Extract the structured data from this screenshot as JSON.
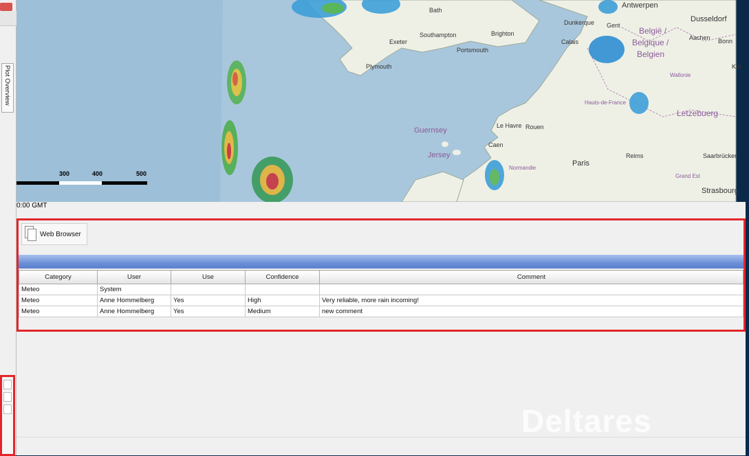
{
  "sidebar": {
    "plot_overview_label": "Plot Overview"
  },
  "map": {
    "cities": [
      "Antwerpen",
      "Bath",
      "Dusseldorf",
      "Dunkerque",
      "Gent",
      "Aachen",
      "Bonn",
      "Southampton",
      "Brighton",
      "Exeter",
      "Portsmouth",
      "Calais",
      "België /",
      "Belgique /",
      "Belgien",
      "Plymouth",
      "Wallonie",
      "Hauts-de-France",
      "Letzebuerg",
      "Guernsey",
      "Le Havre",
      "Rouen",
      "Caen",
      "Jersey",
      "Reims",
      "Saarbrücken",
      "Paris",
      "Grand Est",
      "Strasbourg",
      "Normandie",
      "Kob"
    ],
    "scale": {
      "ticks": [
        "300",
        "400",
        "500"
      ]
    }
  },
  "time_label": "0:00 GMT",
  "toolbar": {
    "web_browser_label": "Web Browser"
  },
  "table": {
    "headers": [
      "Category",
      "User",
      "Use",
      "Confidence",
      "Comment"
    ],
    "rows": [
      [
        "Meteo",
        "System",
        "",
        "",
        ""
      ],
      [
        "Meteo",
        "Anne Hommelberg",
        "Yes",
        "High",
        "Very reliable, more rain incoming!"
      ],
      [
        "Meteo",
        "Anne Hommelberg",
        "Yes",
        "Medium",
        "new comment"
      ]
    ]
  },
  "brand": {
    "watermark": "Deltares"
  },
  "colors": {
    "highlight": "#e3262b",
    "band": "#6c8fd6",
    "sea": "#a9c7dc",
    "land": "#eef0e6"
  }
}
